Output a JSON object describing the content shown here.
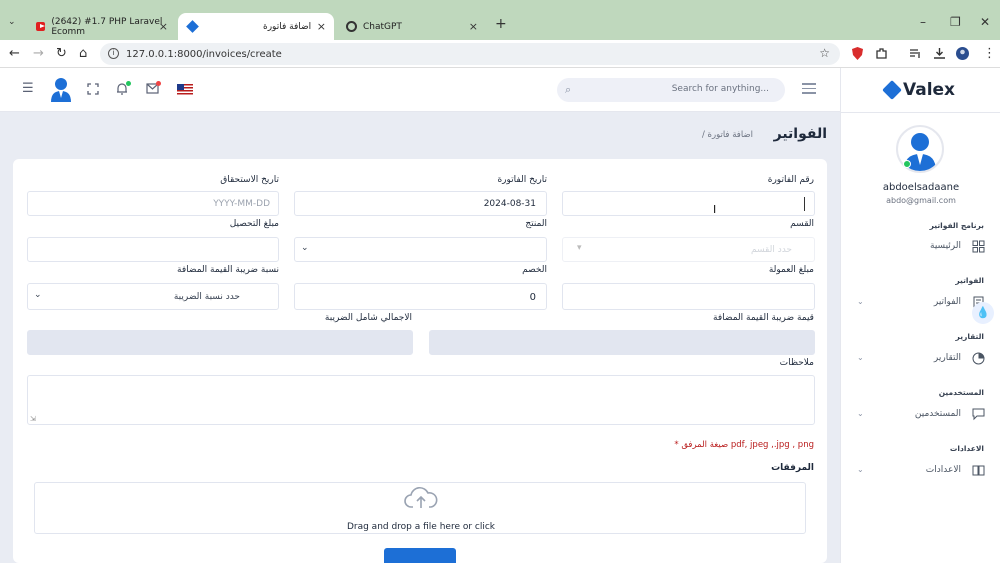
{
  "browser": {
    "tabs": [
      {
        "title": "(2642) #1.7 PHP Laravel Ecomm",
        "icon": "youtube-icon",
        "active": false
      },
      {
        "title": "اضافة فاتورة",
        "icon": "valex-icon",
        "active": true
      },
      {
        "title": "ChatGPT",
        "icon": "chatgpt-icon",
        "active": false
      }
    ],
    "new_tab": "+",
    "url": "127.0.0.1:8000/invoices/create"
  },
  "header": {
    "search_placeholder": "Search for anything..."
  },
  "sidebar": {
    "brand": "Valex",
    "user_name": "abdoelsadaane",
    "user_email": "abdo@gmail.com",
    "sections": [
      {
        "category": "برنامج الفواتير",
        "item": "الرئيسية"
      },
      {
        "category": "الفواتير",
        "item": "الفواتير"
      },
      {
        "category": "التقارير",
        "item": "التقارير"
      },
      {
        "category": "المستخدمين",
        "item": "المستخدمين"
      },
      {
        "category": "الاعدادات",
        "item": "الاعدادات"
      }
    ]
  },
  "page": {
    "title": "الفواتير",
    "breadcrumb": "/ اضافة فاتورة"
  },
  "form": {
    "invoice_number_label": "رقم الفاتورة",
    "invoice_date_label": "تاريخ الفاتورة",
    "invoice_date_value": "2024-08-31",
    "due_date_label": "تاريخ الاستحقاق",
    "due_date_placeholder": "YYYY-MM-DD",
    "section_label": "القسم",
    "section_placeholder": "حدد القسم",
    "product_label": "المنتج",
    "collection_label": "مبلغ التحصيل",
    "commission_label": "مبلغ العمولة",
    "discount_label": "الخصم",
    "discount_value": "0",
    "vat_rate_label": "نسبة ضريبة القيمة المضافة",
    "vat_rate_placeholder": "حدد نسبة الضريبة",
    "vat_value_label": "قيمة ضريبة القيمة المضافة",
    "total_label": "الاجمالي شامل الضريبة",
    "notes_label": "ملاحظات",
    "attachment_hint": "* صيغة المرفق pdf, jpeg ,.jpg , png",
    "attachments_label": "المرفقات",
    "dropzone_text": "Drag and drop a file here or click"
  }
}
